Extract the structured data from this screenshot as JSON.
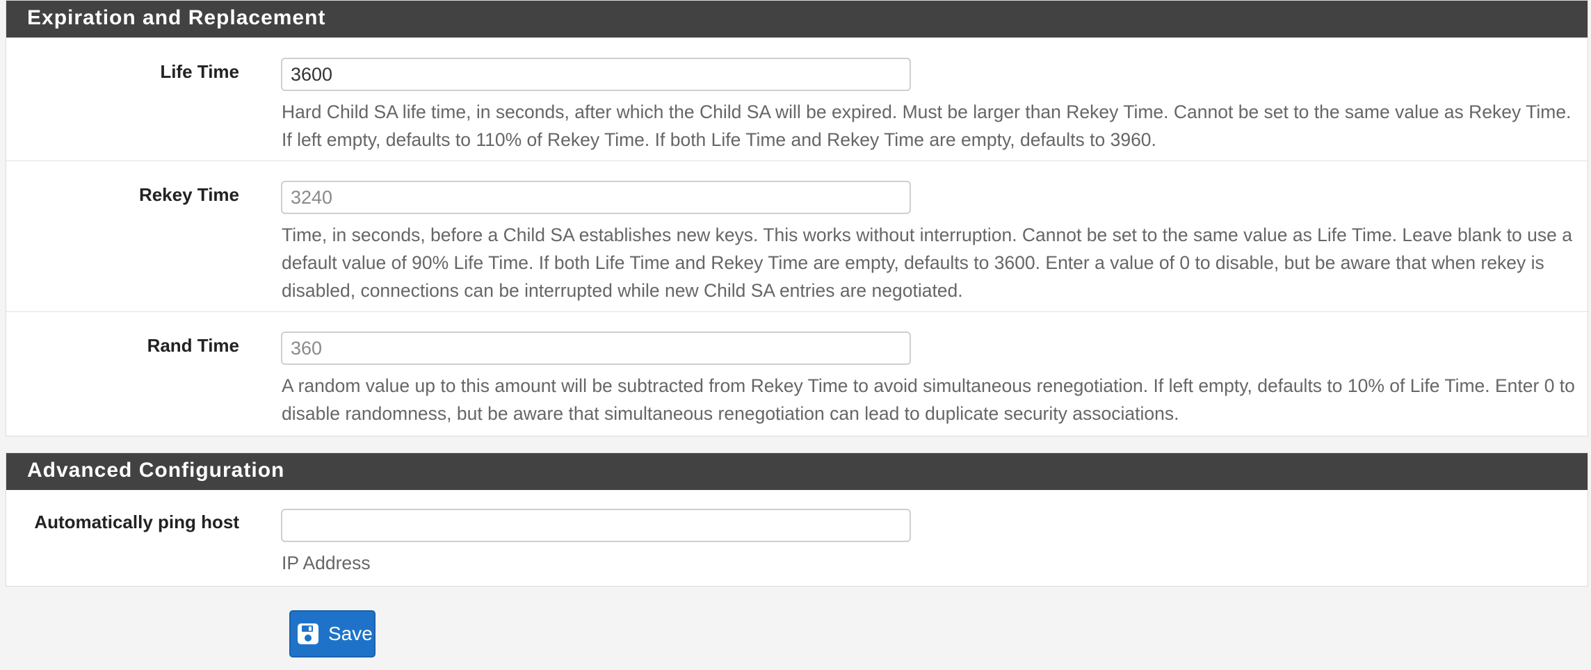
{
  "sections": {
    "expiration": {
      "title": "Expiration and Replacement",
      "life_time": {
        "label": "Life Time",
        "value": "3600",
        "placeholder": "",
        "help": "Hard Child SA life time, in seconds, after which the Child SA will be expired. Must be larger than Rekey Time. Cannot be set to the same value as Rekey Time. If left empty, defaults to 110% of Rekey Time. If both Life Time and Rekey Time are empty, defaults to 3960."
      },
      "rekey_time": {
        "label": "Rekey Time",
        "value": "",
        "placeholder": "3240",
        "help": "Time, in seconds, before a Child SA establishes new keys. This works without interruption. Cannot be set to the same value as Life Time. Leave blank to use a default value of 90% Life Time. If both Life Time and Rekey Time are empty, defaults to 3600. Enter a value of 0 to disable, but be aware that when rekey is disabled, connections can be interrupted while new Child SA entries are negotiated."
      },
      "rand_time": {
        "label": "Rand Time",
        "value": "",
        "placeholder": "360",
        "help": "A random value up to this amount will be subtracted from Rekey Time to avoid simultaneous renegotiation. If left empty, defaults to 10% of Life Time. Enter 0 to disable randomness, but be aware that simultaneous renegotiation can lead to duplicate security associations."
      }
    },
    "advanced": {
      "title": "Advanced Configuration",
      "ping_host": {
        "label": "Automatically ping host",
        "value": "",
        "placeholder": "",
        "help": "IP Address"
      }
    }
  },
  "save_button": {
    "label": "Save",
    "icon": "save-icon",
    "color": "#1e73c8"
  },
  "colors": {
    "heading_bg": "#424242",
    "page_bg": "#f4f4f4"
  }
}
